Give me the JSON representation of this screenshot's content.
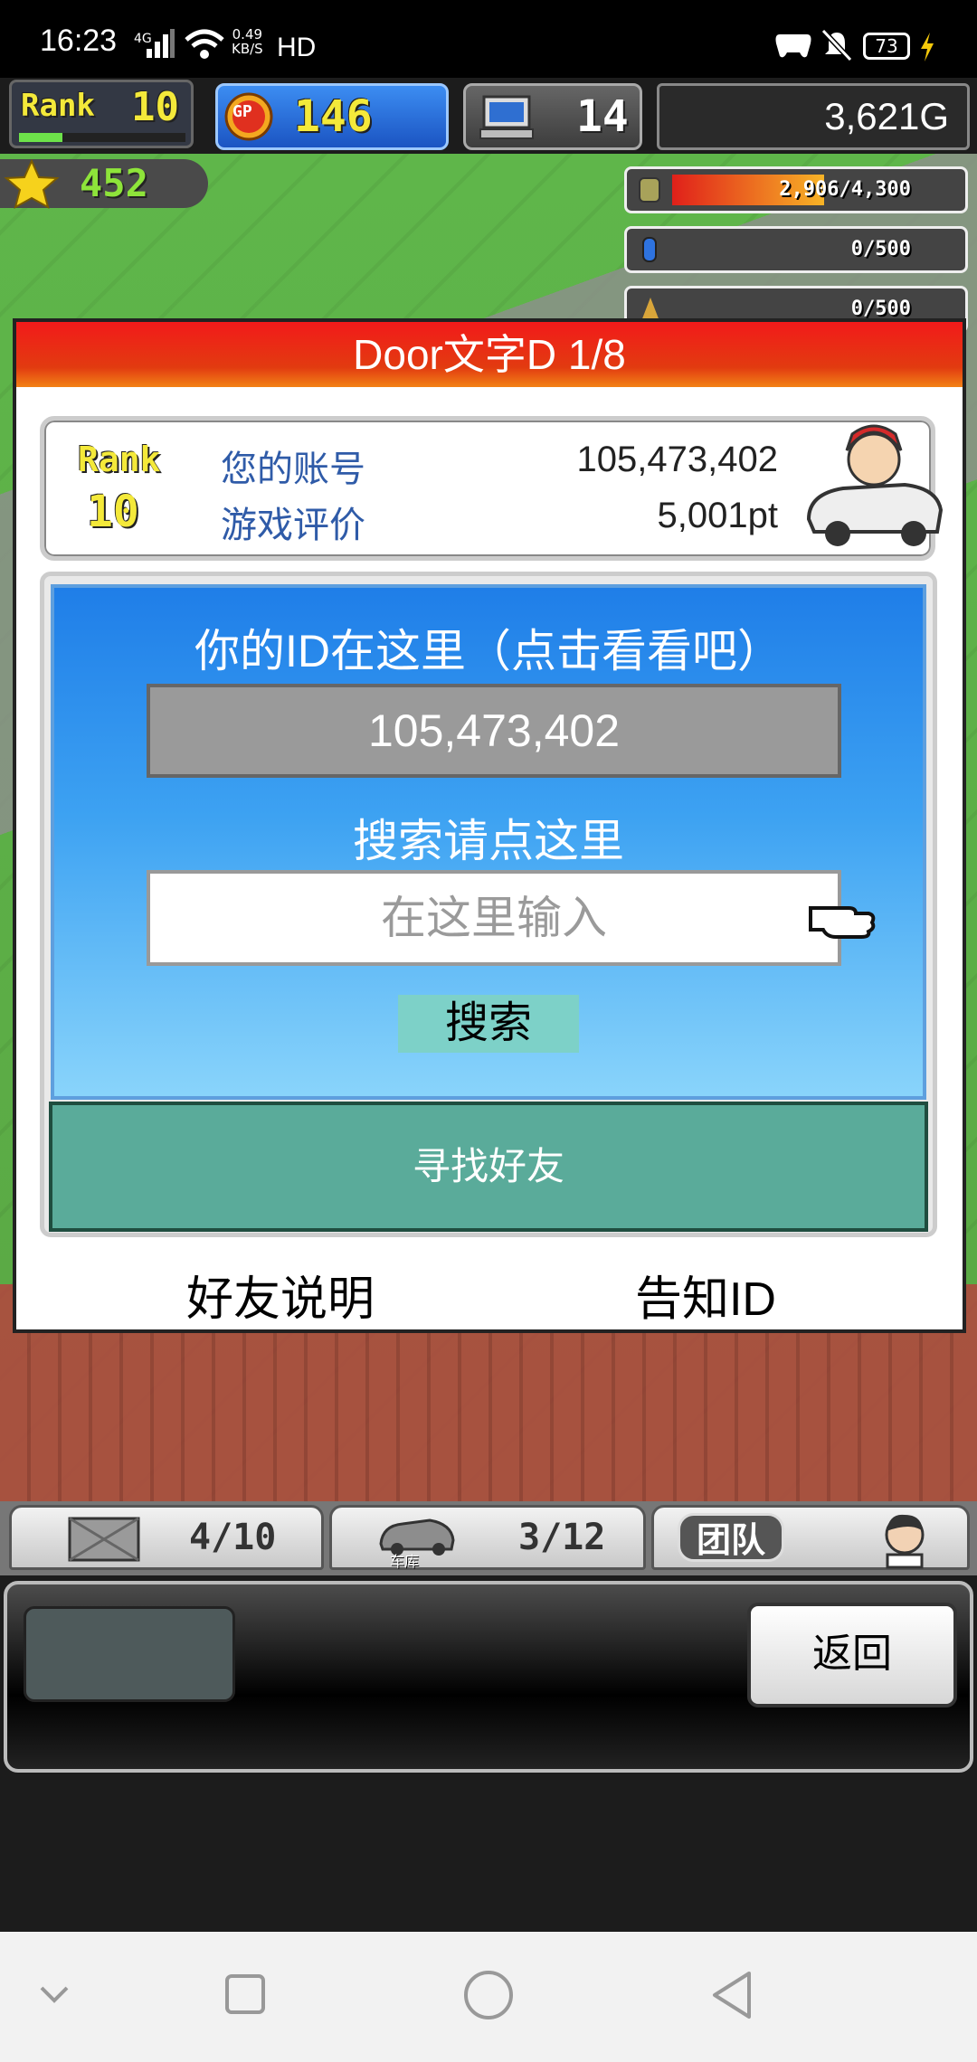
{
  "status_bar": {
    "time": "16:23",
    "network": "4G",
    "speed_value": "0.49",
    "speed_unit": "KB/S",
    "hd": "HD",
    "battery": "73"
  },
  "hud": {
    "rank_label": "Rank",
    "rank_value": "10",
    "gp_label": "GP",
    "gp_value": "146",
    "pc_value": "14",
    "gold": "3,621G",
    "stars": "452",
    "resources": [
      {
        "name": "coins",
        "value": "2,906/4,300",
        "fill": 0.676
      },
      {
        "name": "fuel",
        "value": "0/500",
        "fill": 0
      },
      {
        "name": "parts",
        "value": "0/500",
        "fill": 0
      }
    ]
  },
  "popup": {
    "title": "Door文字D 1/8",
    "card": {
      "rank_label": "Rank",
      "rank_value": "10",
      "account_label": "您的账号",
      "account_value": "105,473,402",
      "rating_label": "游戏评价",
      "rating_value": "5,001pt"
    },
    "id_caption": "你的ID在这里（点击看看吧）",
    "id_value": "105,473,402",
    "search_caption": "搜索请点这里",
    "search_placeholder": "在这里输入",
    "search_button": "搜索",
    "find_friend": "寻找好友",
    "friend_help": "好友说明",
    "notify_id": "告知ID"
  },
  "bottom": {
    "tab1_count": "4/10",
    "tab2_label": "车库",
    "tab2_count": "3/12",
    "tab3_label": "团队",
    "back_button": "返回"
  }
}
